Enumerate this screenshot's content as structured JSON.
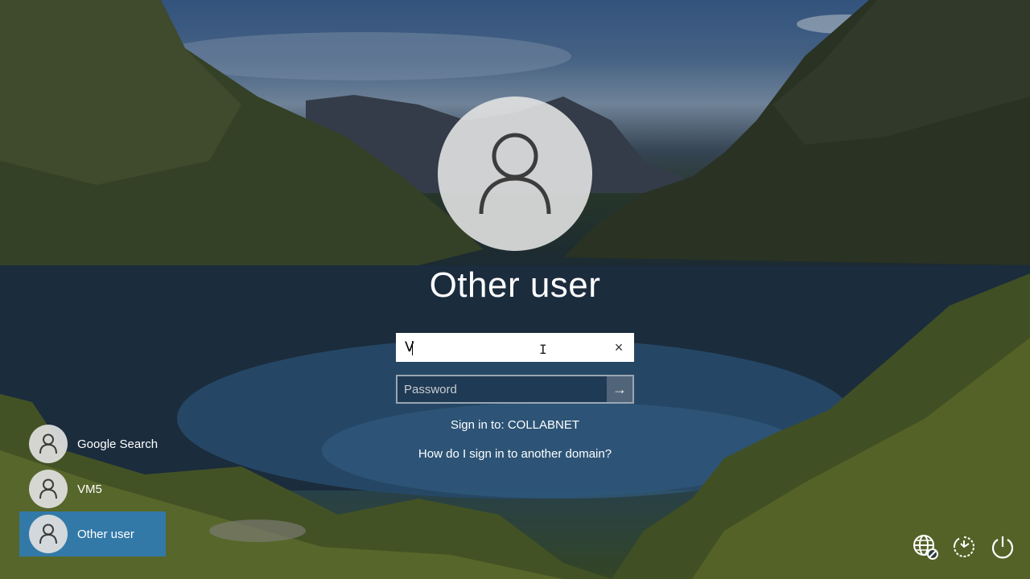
{
  "login": {
    "title": "Other user",
    "username_value": "V",
    "password_placeholder": "Password",
    "sign_in_to": "Sign in to: COLLABNET",
    "help_link": "How do I sign in to another domain?",
    "clear_icon": "×",
    "submit_icon": "→"
  },
  "users": [
    {
      "label": "Google Search",
      "selected": false
    },
    {
      "label": "VM5",
      "selected": false
    },
    {
      "label": "Other user",
      "selected": true
    }
  ],
  "system_icons": [
    "network-icon",
    "ease-of-access-icon",
    "power-icon"
  ],
  "colors": {
    "selected_tile": "#2d7dbe",
    "avatar_bg": "#e1e1e1",
    "avatar_glyph": "#3c3c3c"
  }
}
